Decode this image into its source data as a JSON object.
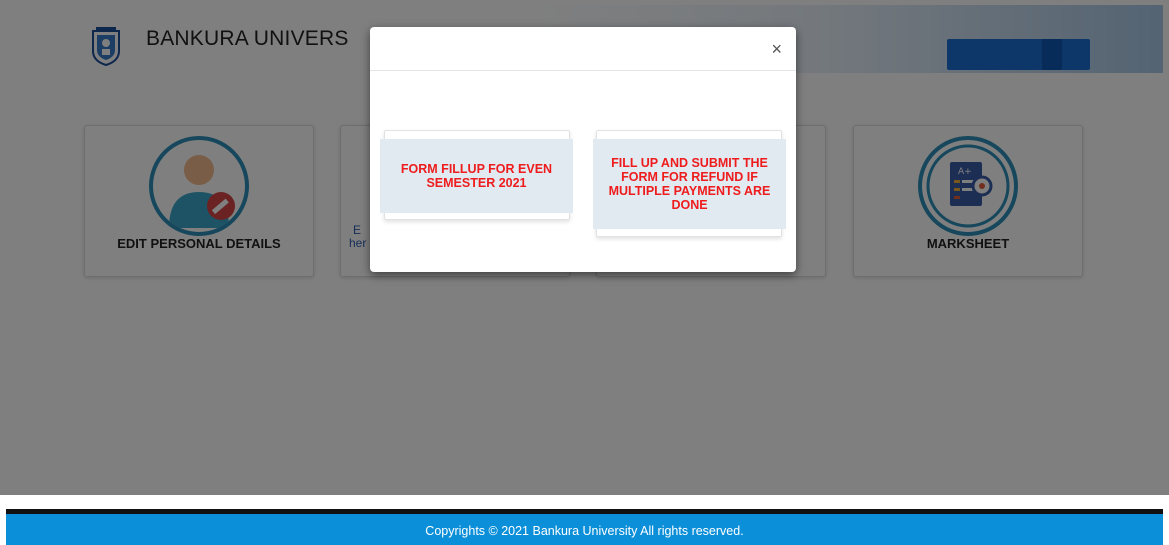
{
  "header": {
    "brand": "BANKURA UNIVERS",
    "accent": "#1a6fd0"
  },
  "cards": [
    {
      "label": "EDIT PERSONAL DETAILS",
      "icon": "user-edit-icon"
    },
    {
      "label": "",
      "link_text_1": "E",
      "link_text_2": "her",
      "icon": ""
    },
    {
      "label": "",
      "icon": ""
    },
    {
      "label": "MARKSHEET",
      "icon": "marksheet-icon"
    }
  ],
  "modal": {
    "close_label": "×",
    "options": [
      {
        "label": "FORM FILLUP FOR EVEN SEMESTER 2021"
      },
      {
        "label": "FILL UP AND SUBMIT THE FORM FOR REFUND IF MULTIPLE PAYMENTS ARE DONE"
      }
    ],
    "option_text_color": "#ee1c1c",
    "option_bg": "#e1e9f1"
  },
  "footer": {
    "text": "Copyrights © 2021 Bankura University All rights reserved.",
    "bg": "#0b8fd9"
  }
}
